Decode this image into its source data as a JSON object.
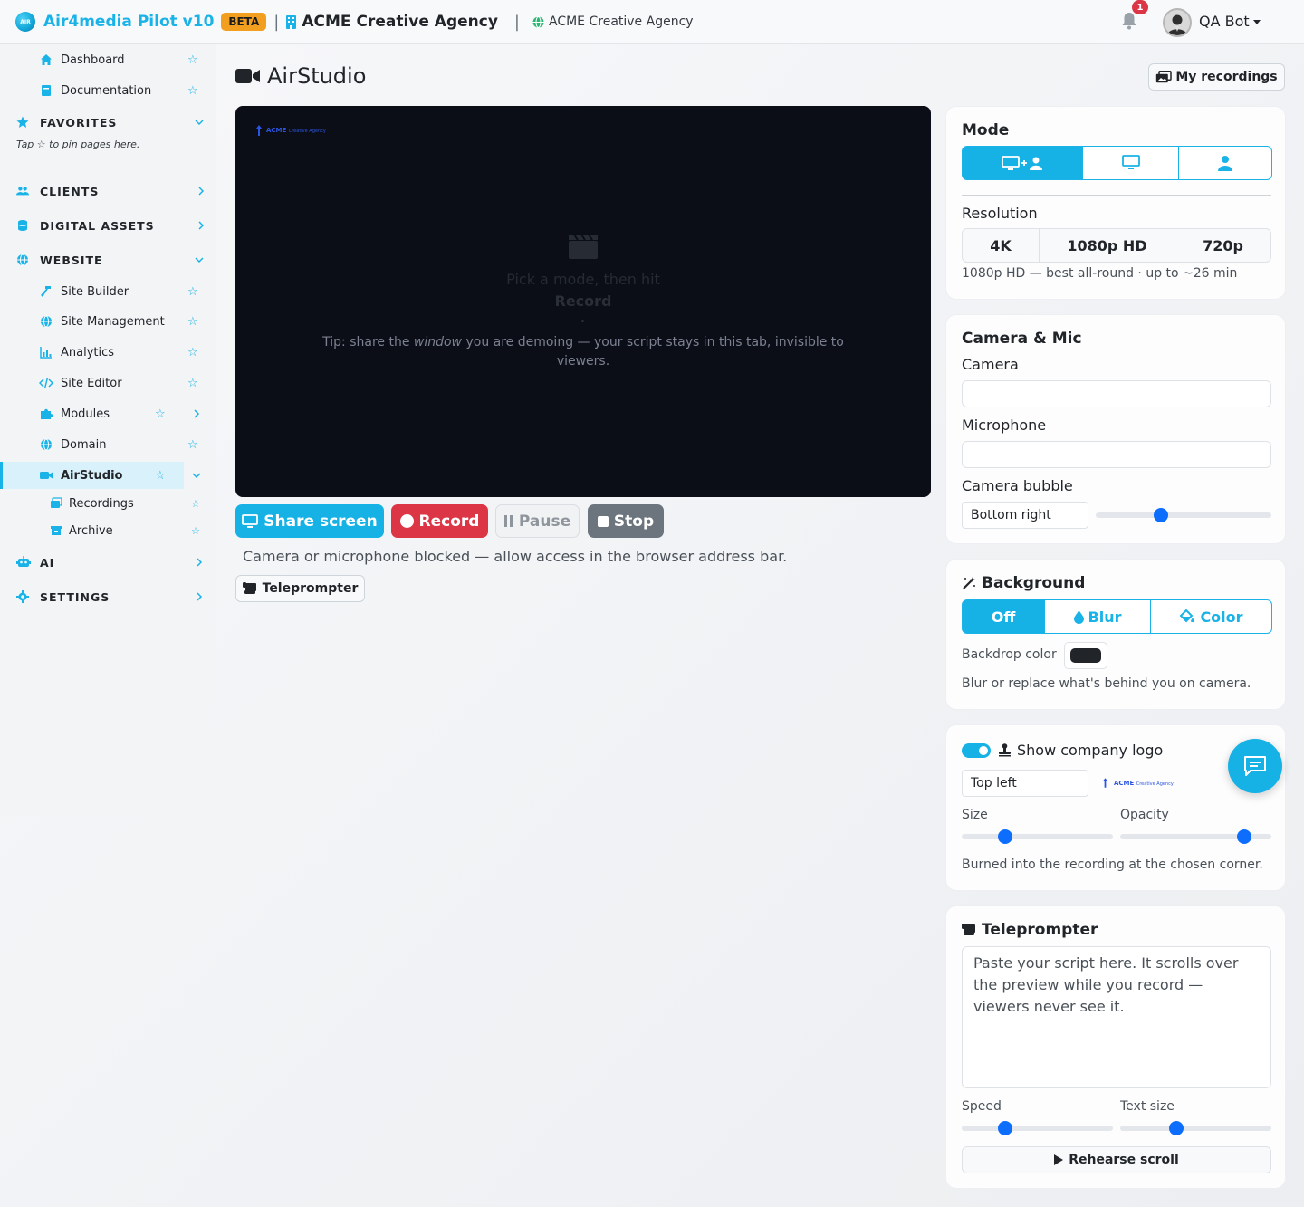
{
  "topbar": {
    "brand_logo_text": "AIR",
    "brand": "Air4media Pilot v10",
    "beta": "BETA",
    "agency": "ACME Creative Agency",
    "agency_sub": "ACME Creative Agency",
    "notifications": "1",
    "user": "QA Bot"
  },
  "sidebar": {
    "dashboard": "Dashboard",
    "documentation": "Documentation",
    "favorites": "FAVORITES",
    "fav_hint": "Tap ☆ to pin pages here.",
    "clients": "CLIENTS",
    "digital_assets": "DIGITAL ASSETS",
    "website": "WEBSITE",
    "site_builder": "Site Builder",
    "site_management": "Site Management",
    "analytics": "Analytics",
    "site_editor": "Site Editor",
    "modules": "Modules",
    "domain": "Domain",
    "airstudio": "AirStudio",
    "recordings": "Recordings",
    "archive": "Archive",
    "ai": "AI",
    "settings": "SETTINGS"
  },
  "main": {
    "title": "AirStudio",
    "my_recordings": "My recordings",
    "preview": {
      "logo_brand": "ACME",
      "logo_sub": "Creative Agency",
      "line1": "Pick a mode, then hit",
      "line2": "Record",
      "tip_prefix": "Tip: share the ",
      "tip_em": "window",
      "tip_suffix": " you are demoing — your script stays in this tab, invisible to viewers."
    },
    "share_screen": "Share screen",
    "record": "Record",
    "pause": "Pause",
    "stop": "Stop",
    "blocked": "Camera or microphone blocked — allow access in the browser address bar.",
    "teleprompter_btn": "Teleprompter"
  },
  "mode_card": {
    "title": "Mode",
    "modes": [
      "screen-camera",
      "screen",
      "camera"
    ],
    "active_mode": "screen-camera",
    "resolution_label": "Resolution",
    "resolutions": [
      "4K",
      "1080p HD",
      "720p"
    ],
    "active_resolution": "1080p HD",
    "resolution_hint": "1080p HD — best all-round · up to ~26 min"
  },
  "cam_card": {
    "title": "Camera & Mic",
    "camera_label": "Camera",
    "camera_value": "",
    "mic_label": "Microphone",
    "mic_value": "",
    "bubble_label": "Camera bubble",
    "bubble_position": "Bottom right",
    "bubble_size_fraction": 0.37
  },
  "bg_card": {
    "title": "Background",
    "options": [
      "Off",
      "Blur",
      "Color"
    ],
    "active": "Off",
    "backdrop_label": "Backdrop color",
    "backdrop_color": "#212529",
    "hint": "Blur or replace what's behind you on camera."
  },
  "logo_card": {
    "title": "Show company logo",
    "enabled": true,
    "position": "Top left",
    "preview_brand": "ACME",
    "preview_sub": "Creative Agency",
    "size_label": "Size",
    "size_fraction": 0.29,
    "opacity_label": "Opacity",
    "opacity_fraction": 0.82,
    "hint": "Burned into the recording at the chosen corner."
  },
  "tele_card": {
    "title": "Teleprompter",
    "placeholder": "Paste your script here. It scrolls over the preview while you record — viewers never see it.",
    "speed_label": "Speed",
    "speed_fraction": 0.29,
    "text_size_label": "Text size",
    "text_size_fraction": 0.37,
    "rehearse": "Rehearse scroll"
  },
  "colors": {
    "accent": "#16b2e6",
    "danger": "#dc3545",
    "secondary": "#6c757d",
    "slider": "#0d6efd",
    "beta": "#f29e1f"
  }
}
